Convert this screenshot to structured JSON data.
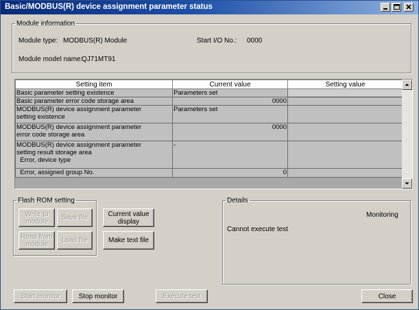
{
  "window": {
    "title": "Basic/MODBUS(R) device assignment parameter status"
  },
  "module_info": {
    "legend": "Module information",
    "type_label": "Module type:",
    "type_value": "MODBUS(R) Module",
    "start_io_label": "Start I/O No.:",
    "start_io_value": "0000",
    "model_label": "Module model name:",
    "model_value": "QJ71MT91"
  },
  "table": {
    "headers": [
      "Setting item",
      "Current value",
      "Setting value"
    ],
    "rows": [
      {
        "item": "Basic parameter setting existence",
        "current": "Parameters set",
        "setting": ""
      },
      {
        "item": "Basic parameter error code storage area",
        "current": "0000",
        "setting": ""
      },
      {
        "item": "MODBUS(R) device assignment parameter\nsetting existence",
        "current": "Parameters set",
        "setting": ""
      },
      {
        "item": "MODBUS(R) device assignment parameter\nerror code storage area",
        "current": "0000",
        "setting": ""
      },
      {
        "item": "MODBUS(R) device assignment parameter\nsetting result storage area\n  Error, device type",
        "current": "-",
        "setting": ""
      },
      {
        "item": "  Error, assigned group No.",
        "current": "0",
        "setting": ""
      }
    ]
  },
  "flash_rom": {
    "legend": "Flash ROM setting",
    "write_to_module": "Write to module",
    "save_file": "Save file",
    "read_from_module": "Read from module",
    "load_file": "Load file"
  },
  "current_value_display": "Current value display",
  "make_text_file": "Make text file",
  "details": {
    "legend": "Details",
    "status": "Monitoring",
    "message": "Cannot execute test"
  },
  "bottom": {
    "start_monitor": "Start monitor",
    "stop_monitor": "Stop monitor",
    "execute_test": "Execute test",
    "close": "Close"
  },
  "colors": {
    "title_start": "#0a2a78",
    "title_end": "#8fb1de",
    "face": "#d4d0c8"
  }
}
